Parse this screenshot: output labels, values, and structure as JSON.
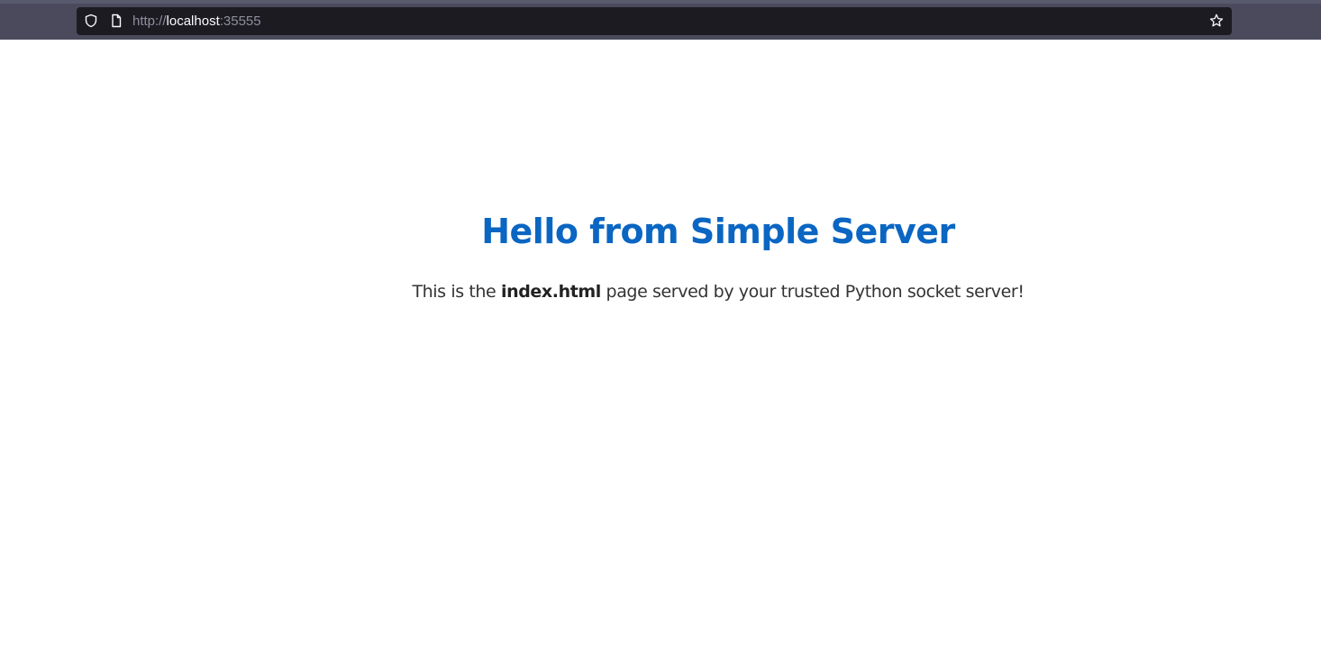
{
  "browser": {
    "url_scheme": "http://",
    "url_host": "localhost",
    "url_port": ":35555",
    "icons": {
      "shield": "shield-icon",
      "page": "page-icon",
      "bookmark": "star-icon"
    }
  },
  "page": {
    "heading": "Hello from Simple Server",
    "paragraph_before": "This is the ",
    "paragraph_bold": "index.html",
    "paragraph_after": " page served by your trusted Python socket server!",
    "heading_color": "#0a66c2"
  }
}
